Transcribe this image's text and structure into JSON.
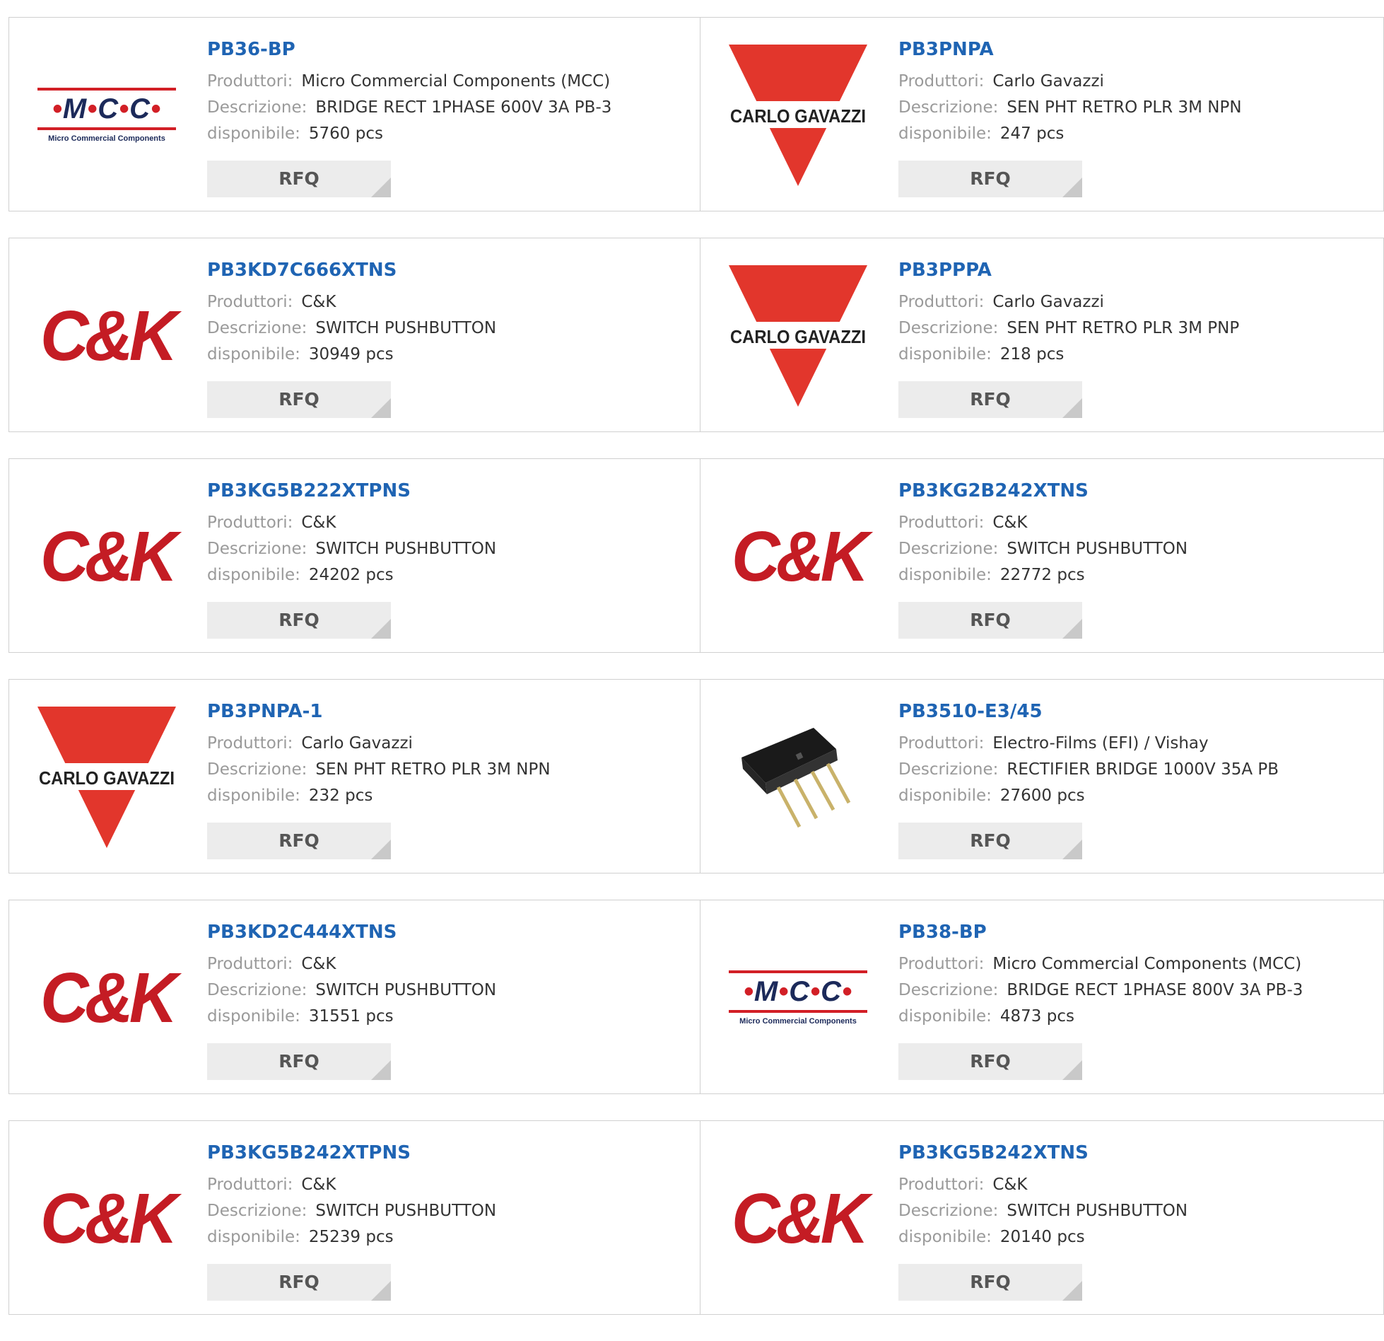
{
  "labels": {
    "manufacturer": "Produttori:",
    "description": "Descrizione:",
    "available": "disponibile:",
    "rfq": "RFQ"
  },
  "logos": {
    "mcc_mark_1": "M",
    "mcc_mark_2": "C",
    "mcc_mark_3": "C",
    "mcc_sub": "Micro Commercial Components",
    "cg_text": "CARLO GAVAZZI",
    "ck_text": "C&K"
  },
  "products": [
    {
      "pn": "PB36-BP",
      "manufacturer": "Micro Commercial Components (MCC)",
      "description": "BRIDGE RECT 1PHASE 600V 3A PB-3",
      "available": "5760 pcs",
      "logo": "mcc"
    },
    {
      "pn": "PB3PNPA",
      "manufacturer": "Carlo Gavazzi",
      "description": "SEN PHT RETRO PLR 3M NPN",
      "available": "247 pcs",
      "logo": "carlo-gavazzi"
    },
    {
      "pn": "PB3KD7C666XTNS",
      "manufacturer": "C&K",
      "description": "SWITCH PUSHBUTTON",
      "available": "30949 pcs",
      "logo": "ck"
    },
    {
      "pn": "PB3PPPA",
      "manufacturer": "Carlo Gavazzi",
      "description": "SEN PHT RETRO PLR 3M PNP",
      "available": "218 pcs",
      "logo": "carlo-gavazzi"
    },
    {
      "pn": "PB3KG5B222XTPNS",
      "manufacturer": "C&K",
      "description": "SWITCH PUSHBUTTON",
      "available": "24202 pcs",
      "logo": "ck"
    },
    {
      "pn": "PB3KG2B242XTNS",
      "manufacturer": "C&K",
      "description": "SWITCH PUSHBUTTON",
      "available": "22772 pcs",
      "logo": "ck"
    },
    {
      "pn": "PB3PNPA-1",
      "manufacturer": "Carlo Gavazzi",
      "description": "SEN PHT RETRO PLR 3M NPN",
      "available": "232 pcs",
      "logo": "carlo-gavazzi"
    },
    {
      "pn": "PB3510-E3/45",
      "manufacturer": "Electro-Films (EFI) / Vishay",
      "description": "RECTIFIER BRIDGE 1000V 35A PB",
      "available": "27600 pcs",
      "logo": "bridge-rectifier-photo"
    },
    {
      "pn": "PB3KD2C444XTNS",
      "manufacturer": "C&K",
      "description": "SWITCH PUSHBUTTON",
      "available": "31551 pcs",
      "logo": "ck"
    },
    {
      "pn": "PB38-BP",
      "manufacturer": "Micro Commercial Components (MCC)",
      "description": "BRIDGE RECT 1PHASE 800V 3A PB-3",
      "available": "4873 pcs",
      "logo": "mcc"
    },
    {
      "pn": "PB3KG5B242XTPNS",
      "manufacturer": "C&K",
      "description": "SWITCH PUSHBUTTON",
      "available": "25239 pcs",
      "logo": "ck"
    },
    {
      "pn": "PB3KG5B242XTNS",
      "manufacturer": "C&K",
      "description": "SWITCH PUSHBUTTON",
      "available": "20140 pcs",
      "logo": "ck"
    }
  ],
  "colors": {
    "link": "#1f64b3",
    "label": "#9a9a9a",
    "value": "#333333",
    "brand_red": "#d21f26",
    "ck_red": "#c41c24",
    "mcc_navy": "#1c2a5a",
    "button_bg": "#ececec",
    "border": "#d0d0d0"
  }
}
